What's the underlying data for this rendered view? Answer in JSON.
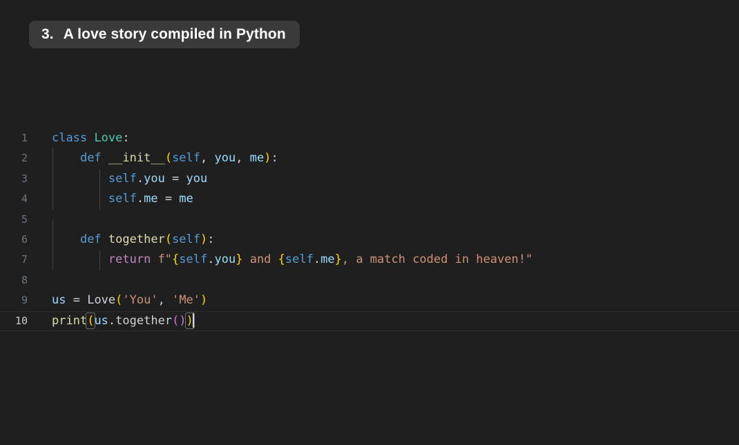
{
  "title": {
    "index": "3.",
    "text": "A love story compiled in Python"
  },
  "colors": {
    "background": "#1f1f1f",
    "pill_background": "#3a3a3a",
    "pill_text": "#ffffff",
    "gutter_text": "#6e7681",
    "gutter_active_text": "#cccccc",
    "keyword": "#569cd6",
    "class_name": "#4ec9b0",
    "function_name": "#dcdcaa",
    "parameter": "#9cdcfe",
    "control": "#c586c0",
    "string": "#ce9178",
    "bracket_yellow": "#ffd700",
    "bracket_magenta": "#da70d6",
    "plain_text": "#d4d4d4",
    "indent_guide": "#3f4145"
  },
  "editor": {
    "language": "Python",
    "active_line": 10,
    "line_numbers": [
      "1",
      "2",
      "3",
      "4",
      "5",
      "6",
      "7",
      "8",
      "9",
      "10"
    ],
    "code_plain": "class Love:\n    def __init__(self, you, me):\n        self.you = you\n        self.me = me\n\n    def together(self):\n        return f\"{self.you} and {self.me}, a match coded in heaven!\"\n\nus = Love('You', 'Me')\nprint(us.together())",
    "lines": [
      {
        "number": "1",
        "tokens": [
          {
            "text": "class",
            "kind": "keyword"
          },
          {
            "text": " ",
            "kind": "plain"
          },
          {
            "text": "Love",
            "kind": "class_name"
          },
          {
            "text": ":",
            "kind": "plain"
          }
        ]
      },
      {
        "number": "2",
        "tokens": [
          {
            "text": "    ",
            "kind": "plain"
          },
          {
            "text": "def",
            "kind": "keyword"
          },
          {
            "text": " ",
            "kind": "plain"
          },
          {
            "text": "__init__",
            "kind": "function_name"
          },
          {
            "text": "(",
            "kind": "bracket_yellow"
          },
          {
            "text": "self",
            "kind": "keyword"
          },
          {
            "text": ", ",
            "kind": "plain"
          },
          {
            "text": "you",
            "kind": "parameter"
          },
          {
            "text": ", ",
            "kind": "plain"
          },
          {
            "text": "me",
            "kind": "parameter"
          },
          {
            "text": ")",
            "kind": "bracket_yellow"
          },
          {
            "text": ":",
            "kind": "plain"
          }
        ]
      },
      {
        "number": "3",
        "tokens": [
          {
            "text": "        ",
            "kind": "plain"
          },
          {
            "text": "self",
            "kind": "keyword"
          },
          {
            "text": ".",
            "kind": "plain"
          },
          {
            "text": "you",
            "kind": "parameter"
          },
          {
            "text": " = ",
            "kind": "plain"
          },
          {
            "text": "you",
            "kind": "parameter"
          }
        ]
      },
      {
        "number": "4",
        "tokens": [
          {
            "text": "        ",
            "kind": "plain"
          },
          {
            "text": "self",
            "kind": "keyword"
          },
          {
            "text": ".",
            "kind": "plain"
          },
          {
            "text": "me",
            "kind": "parameter"
          },
          {
            "text": " = ",
            "kind": "plain"
          },
          {
            "text": "me",
            "kind": "parameter"
          }
        ]
      },
      {
        "number": "5",
        "tokens": []
      },
      {
        "number": "6",
        "tokens": [
          {
            "text": "    ",
            "kind": "plain"
          },
          {
            "text": "def",
            "kind": "keyword"
          },
          {
            "text": " ",
            "kind": "plain"
          },
          {
            "text": "together",
            "kind": "function_name"
          },
          {
            "text": "(",
            "kind": "bracket_yellow"
          },
          {
            "text": "self",
            "kind": "keyword"
          },
          {
            "text": ")",
            "kind": "bracket_yellow"
          },
          {
            "text": ":",
            "kind": "plain"
          }
        ]
      },
      {
        "number": "7",
        "tokens": [
          {
            "text": "        ",
            "kind": "plain"
          },
          {
            "text": "return",
            "kind": "control"
          },
          {
            "text": " ",
            "kind": "plain"
          },
          {
            "text": "f\"",
            "kind": "string"
          },
          {
            "text": "{",
            "kind": "bracket_yellow"
          },
          {
            "text": "self",
            "kind": "keyword"
          },
          {
            "text": ".",
            "kind": "plain"
          },
          {
            "text": "you",
            "kind": "parameter"
          },
          {
            "text": "}",
            "kind": "bracket_yellow"
          },
          {
            "text": " and ",
            "kind": "string"
          },
          {
            "text": "{",
            "kind": "bracket_yellow"
          },
          {
            "text": "self",
            "kind": "keyword"
          },
          {
            "text": ".",
            "kind": "plain"
          },
          {
            "text": "me",
            "kind": "parameter"
          },
          {
            "text": "}",
            "kind": "bracket_yellow"
          },
          {
            "text": ", a match coded in heaven!\"",
            "kind": "string"
          }
        ]
      },
      {
        "number": "8",
        "tokens": []
      },
      {
        "number": "9",
        "tokens": [
          {
            "text": "us",
            "kind": "parameter"
          },
          {
            "text": " = ",
            "kind": "plain"
          },
          {
            "text": "Love",
            "kind": "identifier"
          },
          {
            "text": "(",
            "kind": "bracket_yellow"
          },
          {
            "text": "'You'",
            "kind": "string"
          },
          {
            "text": ", ",
            "kind": "plain"
          },
          {
            "text": "'Me'",
            "kind": "string"
          },
          {
            "text": ")",
            "kind": "bracket_yellow"
          }
        ]
      },
      {
        "number": "10",
        "tokens": [
          {
            "text": "print",
            "kind": "function_name"
          },
          {
            "text": "(",
            "kind": "bracket_yellow",
            "matched": true
          },
          {
            "text": "us",
            "kind": "parameter"
          },
          {
            "text": ".",
            "kind": "plain"
          },
          {
            "text": "together",
            "kind": "identifier"
          },
          {
            "text": "(",
            "kind": "bracket_magenta"
          },
          {
            "text": ")",
            "kind": "bracket_magenta"
          },
          {
            "text": ")",
            "kind": "bracket_yellow",
            "matched": true
          }
        ],
        "caret_after": true
      }
    ],
    "indent_guides": [
      {
        "line": 2,
        "level": 1
      },
      {
        "line": 3,
        "level": 1
      },
      {
        "line": 3,
        "level": 2
      },
      {
        "line": 4,
        "level": 1
      },
      {
        "line": 4,
        "level": 2
      },
      {
        "line": 5,
        "level": 1
      },
      {
        "line": 6,
        "level": 1
      },
      {
        "line": 7,
        "level": 1
      },
      {
        "line": 7,
        "level": 2
      }
    ]
  }
}
